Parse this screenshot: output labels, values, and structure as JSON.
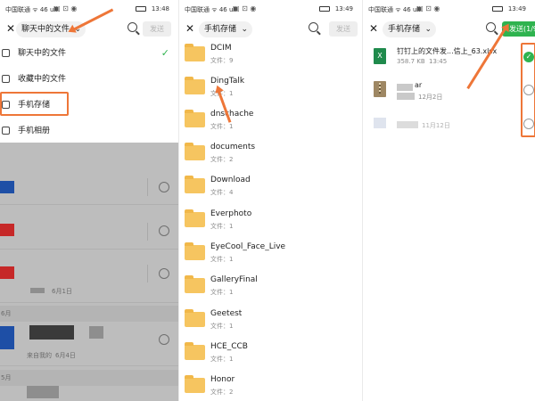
{
  "panel1": {
    "status": {
      "carrier": "中国联通 ᯤ 46 ull",
      "time": "13:48"
    },
    "header": {
      "dropdown_label": "聊天中的文件",
      "send_label": "发送"
    },
    "menu": [
      {
        "label": "聊天中的文件",
        "icon": "chat-file-icon",
        "checked": true
      },
      {
        "label": "收藏中的文件",
        "icon": "favorite-box-icon",
        "checked": false
      },
      {
        "label": "手机存储",
        "icon": "phone-storage-icon",
        "checked": false
      },
      {
        "label": "手机相册",
        "icon": "photo-album-icon",
        "checked": false
      }
    ],
    "background_list": {
      "date_1": "6月1日",
      "section_1": "6月",
      "row_meta": "来自我的",
      "date_2": "6月4日",
      "section_2": "5月"
    },
    "check_glyph": "✓"
  },
  "panel2": {
    "status": {
      "carrier": "中国联通 ᯤ 46 ull",
      "time": "13:49"
    },
    "header": {
      "dropdown_label": "手机存储",
      "send_label": "发送"
    },
    "folders": [
      {
        "name": "DCIM",
        "count": "文件：9"
      },
      {
        "name": "DingTalk",
        "count": "文件：1"
      },
      {
        "name": "dnschache",
        "count": "文件：1"
      },
      {
        "name": "documents",
        "count": "文件：2"
      },
      {
        "name": "Download",
        "count": "文件：4"
      },
      {
        "name": "Everphoto",
        "count": "文件：1"
      },
      {
        "name": "EyeCool_Face_Live",
        "count": "文件：1"
      },
      {
        "name": "GalleryFinal",
        "count": "文件：1"
      },
      {
        "name": "Geetest",
        "count": "文件：1"
      },
      {
        "name": "HCE_CCB",
        "count": "文件：1"
      },
      {
        "name": "Honor",
        "count": "文件：2"
      }
    ]
  },
  "panel3": {
    "status": {
      "carrier": "中国联通 ᯤ 46 ull",
      "time": "13:49"
    },
    "header": {
      "dropdown_label": "手机存储",
      "send_label": "发送(1/9)"
    },
    "files": [
      {
        "name": "钉钉上的文件发...信上_63.xlsx",
        "size": "358.7 KB",
        "time": "13:45",
        "icon": "xlsx-file-icon",
        "selected": true
      },
      {
        "name": "ar",
        "size": "",
        "time": "12月2日",
        "icon": "zip-file-icon",
        "selected": false
      },
      {
        "name": "",
        "size": "",
        "time": "11月12日",
        "icon": "image-file-icon",
        "selected": false
      }
    ],
    "check_glyph": "✓"
  },
  "close_glyph": "✕",
  "chevron_glyph": "⌄",
  "colors": {
    "accent_green": "#2fb34f",
    "annotation_orange": "#ee7638",
    "folder_yellow": "#f6c560"
  }
}
